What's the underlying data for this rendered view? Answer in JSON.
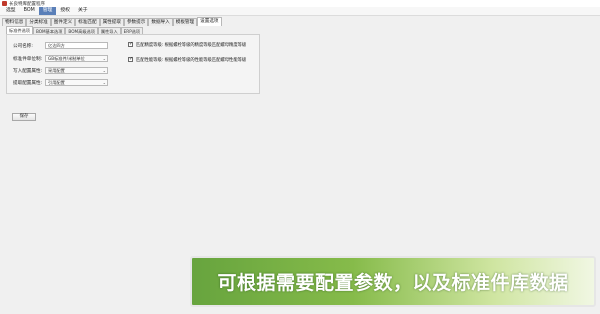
{
  "window": {
    "title": "长良特库配置程序"
  },
  "menu": [
    {
      "label": "选型",
      "active": false
    },
    {
      "label": "BOM",
      "active": false
    },
    {
      "label": "管理",
      "active": true
    },
    {
      "label": "授权",
      "active": false
    },
    {
      "label": "关于",
      "active": false
    }
  ],
  "tabs_primary": [
    {
      "label": "物料信息",
      "active": false
    },
    {
      "label": "分类标准",
      "active": false
    },
    {
      "label": "图件定义",
      "active": false
    },
    {
      "label": "标准匹配",
      "active": false
    },
    {
      "label": "属性提取",
      "active": false
    },
    {
      "label": "参数提示",
      "active": false
    },
    {
      "label": "数据导入",
      "active": false
    },
    {
      "label": "模板管理",
      "active": false
    },
    {
      "label": "设置选项",
      "active": true
    }
  ],
  "tabs_secondary": [
    {
      "label": "标准件选项",
      "active": true
    },
    {
      "label": "BOM基本选项",
      "active": false
    },
    {
      "label": "BOM高级选项",
      "active": false
    },
    {
      "label": "属性导入",
      "active": false
    },
    {
      "label": "ERP选项",
      "active": false
    }
  ],
  "form": {
    "company_label": "公司名称:",
    "company_value": "亿达四方",
    "unit_label": "标准件单位制:",
    "unit_value": "GB标准件/米制单位",
    "import_label": "写入配置属性:",
    "import_value": "采用配置",
    "extract_label": "提取配置属性:",
    "extract_value": "引用配置"
  },
  "checks": [
    {
      "label": "匹配精度等级: 根据螺栓等级的精度等级匹配螺母精度等级",
      "checked": true
    },
    {
      "label": "匹配性能等级: 根据螺栓等级的性能等级匹配螺母性能等级",
      "checked": true
    }
  ],
  "save_label": "保存",
  "caption": "可根据需要配置参数，以及标准件库数据",
  "colors": {
    "accent": "#5a7fb8",
    "caption_green": "#67a43e"
  }
}
